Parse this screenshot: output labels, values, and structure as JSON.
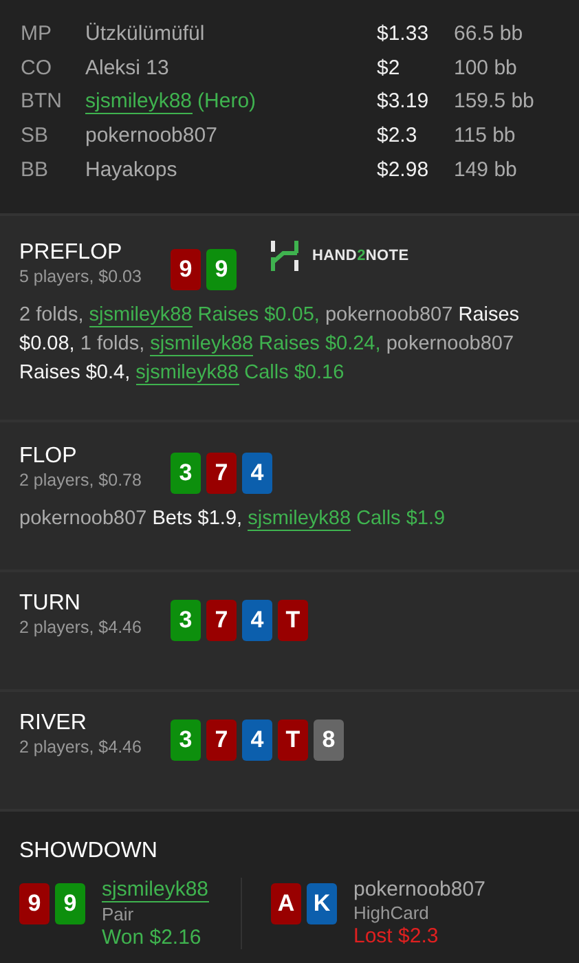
{
  "players": [
    {
      "position": "MP",
      "name": "Ützkülümüfül",
      "hero": false,
      "stack": "$1.33",
      "bb": "66.5 bb"
    },
    {
      "position": "CO",
      "name": "Aleksi 13",
      "hero": false,
      "stack": "$2",
      "bb": "100 bb"
    },
    {
      "position": "BTN",
      "name": "sjsmileyk88",
      "hero": true,
      "hero_tag": "(Hero)",
      "stack": "$3.19",
      "bb": "159.5 bb"
    },
    {
      "position": "SB",
      "name": "pokernoob807",
      "hero": false,
      "stack": "$2.3",
      "bb": "115 bb"
    },
    {
      "position": "BB",
      "name": "Hayakops",
      "hero": false,
      "stack": "$2.98",
      "bb": "149 bb"
    }
  ],
  "streets": [
    {
      "title": "PREFLOP",
      "info": "5 players, $0.03",
      "cards": [
        {
          "rank": "9",
          "color": "#990000"
        },
        {
          "rank": "9",
          "color": "#0d8f0d"
        }
      ],
      "logo": [
        {
          "text": "HAND",
          "accent": false
        },
        {
          "text": "2",
          "accent": true
        },
        {
          "text": "NOTE",
          "accent": false
        }
      ],
      "actions": [
        {
          "kind": "plain",
          "text": "2 folds,"
        },
        {
          "kind": "hero",
          "text": "sjsmileyk88"
        },
        {
          "kind": "hero_action",
          "text": "Raises $0.05,"
        },
        {
          "kind": "plain",
          "text": "pokernoob807"
        },
        {
          "kind": "action",
          "text": "Raises $0.08,"
        },
        {
          "kind": "plain",
          "text": "1 folds,"
        },
        {
          "kind": "hero",
          "text": "sjsmileyk88"
        },
        {
          "kind": "hero_action",
          "text": "Raises $0.24,"
        },
        {
          "kind": "plain",
          "text": "pokernoob807"
        },
        {
          "kind": "action",
          "text": "Raises $0.4,"
        },
        {
          "kind": "hero",
          "text": "sjsmileyk88"
        },
        {
          "kind": "hero_action",
          "text": "Calls $0.16"
        }
      ]
    },
    {
      "title": "FLOP",
      "info": "2 players, $0.78",
      "cards": [
        {
          "rank": "3",
          "color": "#0d8f0d"
        },
        {
          "rank": "7",
          "color": "#990000"
        },
        {
          "rank": "4",
          "color": "#0c5fad"
        }
      ],
      "actions": [
        {
          "kind": "plain",
          "text": "pokernoob807"
        },
        {
          "kind": "action",
          "text": "Bets $1.9,"
        },
        {
          "kind": "hero",
          "text": "sjsmileyk88"
        },
        {
          "kind": "hero_action",
          "text": "Calls $1.9"
        }
      ]
    },
    {
      "title": "TURN",
      "info": "2 players, $4.46",
      "cards": [
        {
          "rank": "3",
          "color": "#0d8f0d"
        },
        {
          "rank": "7",
          "color": "#990000"
        },
        {
          "rank": "4",
          "color": "#0c5fad"
        },
        {
          "rank": "T",
          "color": "#990000"
        }
      ]
    },
    {
      "title": "RIVER",
      "info": "2 players, $4.46",
      "cards": [
        {
          "rank": "3",
          "color": "#0d8f0d"
        },
        {
          "rank": "7",
          "color": "#990000"
        },
        {
          "rank": "4",
          "color": "#0c5fad"
        },
        {
          "rank": "T",
          "color": "#990000"
        },
        {
          "rank": "8",
          "color": "#666666"
        }
      ]
    }
  ],
  "showdown": {
    "title": "SHOWDOWN",
    "hands": [
      {
        "cards": [
          {
            "rank": "9",
            "color": "#990000"
          },
          {
            "rank": "9",
            "color": "#0d8f0d"
          }
        ],
        "name": "sjsmileyk88",
        "hero": true,
        "hand": "Pair",
        "won": true,
        "amount": "Won $2.16"
      },
      {
        "cards": [
          {
            "rank": "A",
            "color": "#990000"
          },
          {
            "rank": "K",
            "color": "#0c5fad"
          }
        ],
        "name": "pokernoob807",
        "hero": false,
        "hand": "HighCard",
        "won": false,
        "amount": "Lost $2.3"
      }
    ]
  }
}
